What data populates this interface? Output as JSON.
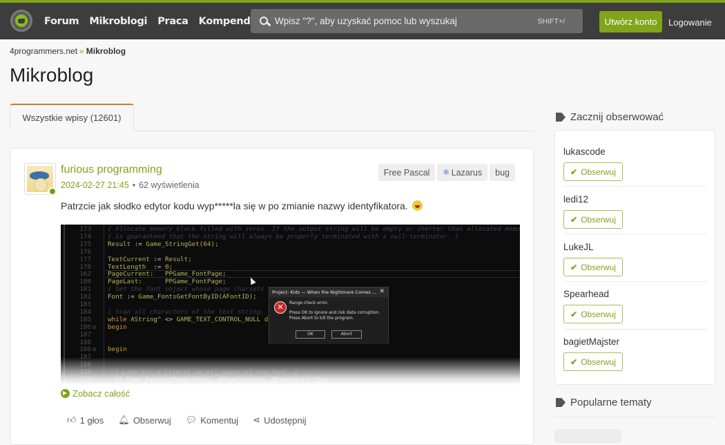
{
  "colors": {
    "brand": "#80a41a",
    "navbar": "#3d3d3d",
    "tab_accent": "#c07a3a"
  },
  "navbar": {
    "logo": "4programmers-logo-icon",
    "links": [
      "Forum",
      "Mikroblogi",
      "Praca",
      "Kompendium"
    ],
    "search": {
      "placeholder": "Wpisz \"?\", aby uzyskać pomoc lub wyszukaj",
      "value": "",
      "shortcut": "SHIFT+/"
    },
    "register_label": "Utwórz konto",
    "login_label": "Logowanie"
  },
  "breadcrumb": {
    "root": "4programmers.net",
    "separator": "»",
    "current": "Mikroblog"
  },
  "page_title": "Mikroblog",
  "tabs": [
    {
      "label": "Wszystkie wpisy (12601)",
      "active": true
    }
  ],
  "post": {
    "author": "furious programming",
    "author_online": true,
    "date": "2024-02-27 21:45",
    "meta_separator": "•",
    "views": "62 wyświetlenia",
    "tags": [
      {
        "label": "Free Pascal",
        "icon": null
      },
      {
        "label": "Lazarus",
        "icon": "lazarus-icon"
      },
      {
        "label": "bug",
        "icon": null
      }
    ],
    "text": "Patrzcie jak słodko edytor kodu wyp*****la się w po zmianie nazwy identyfikatora.",
    "emoji": "rolling-on-floor-laughing-emoji",
    "screenshot": {
      "code_lines": [
        {
          "ln": "173",
          "fold": "",
          "segments": [
            {
              "t": "{ Allocate memory block filled with zeros. If the output string will be empty or shorter than allocated memory",
              "c": "comment"
            }
          ]
        },
        {
          "ln": "174",
          "fold": "",
          "segments": [
            {
              "t": "{ is guaranteed that the string will always be properly terminated with a null-terminator. }",
              "c": "comment"
            }
          ]
        },
        {
          "ln": "175",
          "fold": "",
          "segments": [
            {
              "t": "Result ",
              "c": "ident"
            },
            {
              "t": ":= ",
              "c": "op"
            },
            {
              "t": "Game_StringGet(",
              "c": "ident"
            },
            {
              "t": "64",
              "c": "num"
            },
            {
              "t": ");",
              "c": "ident"
            }
          ]
        },
        {
          "ln": "176",
          "fold": "",
          "segments": []
        },
        {
          "ln": "177",
          "fold": "",
          "segments": [
            {
              "t": "TextCurrent ",
              "c": "ident"
            },
            {
              "t": ":= ",
              "c": "op"
            },
            {
              "t": "Result;",
              "c": "ident"
            }
          ]
        },
        {
          "ln": "178",
          "fold": "",
          "segments": [
            {
              "t": "TextLength  ",
              "c": "ident"
            },
            {
              "t": ":= ",
              "c": "op"
            },
            {
              "t": "0",
              "c": "num"
            },
            {
              "t": ";",
              "c": "ident"
            }
          ]
        },
        {
          "ln": "162",
          "fold": "",
          "highlight": true,
          "segments": [
            {
              "t": "PageCurrent:   PPGame_FontPage;",
              "c": "ident"
            }
          ]
        },
        {
          "ln": "180",
          "fold": "",
          "segments": [
            {
              "t": "PageLast:      PPGame_FontPage;",
              "c": "ident"
            }
          ]
        },
        {
          "ln": "181",
          "fold": "",
          "segments": [
            {
              "t": "{ Get the font object whose page charsets w",
              "c": "comment"
            }
          ]
        },
        {
          "ln": "182",
          "fold": "",
          "segments": [
            {
              "t": "Font ",
              "c": "ident"
            },
            {
              "t": ":= ",
              "c": "op"
            },
            {
              "t": "Game_FontsGetFontByID(AFontID);",
              "c": "ident"
            }
          ]
        },
        {
          "ln": "183",
          "fold": "",
          "segments": []
        },
        {
          "ln": "184",
          "fold": "",
          "segments": [
            {
              "t": "{ Scan all characters of the text string, u",
              "c": "comment"
            }
          ]
        },
        {
          "ln": "185",
          "fold": "",
          "segments": [
            {
              "t": "while ",
              "c": "kw"
            },
            {
              "t": "AString^ ",
              "c": "ident"
            },
            {
              "t": "<> ",
              "c": "op"
            },
            {
              "t": "GAME_TEXT_CONTROL_NULL ",
              "c": "ident"
            },
            {
              "t": "do",
              "c": "kw"
            }
          ]
        },
        {
          "ln": "186",
          "fold": "⊟",
          "segments": [
            {
              "t": "begin",
              "c": "kw"
            }
          ]
        },
        {
          "ln": "187",
          "fold": "",
          "segments": []
        },
        {
          "ln": "188",
          "fold": "",
          "segments": []
        },
        {
          "ln": "186",
          "fold": "⊟",
          "segments": [
            {
              "t": "begin",
              "c": "kw"
            }
          ]
        },
        {
          "ln": "187",
          "fold": "",
          "segments": []
        },
        {
          "ln": "188",
          "fold": "",
          "segments": []
        },
        {
          "ln": "189",
          "fold": "",
          "segments": [
            {
              "t": "  { Look for a literal in all pages of the font. }",
              "c": "comment"
            }
          ]
        },
        {
          "ln": "190",
          "fold": "",
          "segments": [
            {
              "t": "  if Game_FontGetPages(Font, @PageCurrent, @PageLast) then",
              "c": "ident"
            }
          ]
        }
      ],
      "dialog": {
        "title": "Project: Kids — When the Nightmare Comes ...",
        "close": "✕",
        "heading": "Range check error.",
        "line1": "Press OK to ignore and risk data corruption.",
        "line2": "Press Abort to kill the program.",
        "ok_label": "OK",
        "abort_label": "Abort"
      }
    },
    "see_all_label": "Zobacz całość",
    "actions": {
      "vote_label": "1 głos",
      "follow_label": "Obserwuj",
      "comment_label": "Komentuj",
      "share_label": "Udostępnij"
    }
  },
  "sidebar": {
    "follow_heading": "Zacznij obserwować",
    "follow_suggestions": [
      {
        "name": "lukascode",
        "button": "Obserwuj"
      },
      {
        "name": "ledi12",
        "button": "Obserwuj"
      },
      {
        "name": "LukeJL",
        "button": "Obserwuj"
      },
      {
        "name": "Spearhead",
        "button": "Obserwuj"
      },
      {
        "name": "bagietMajster",
        "button": "Obserwuj"
      }
    ],
    "popular_heading": "Popularne tematy"
  }
}
